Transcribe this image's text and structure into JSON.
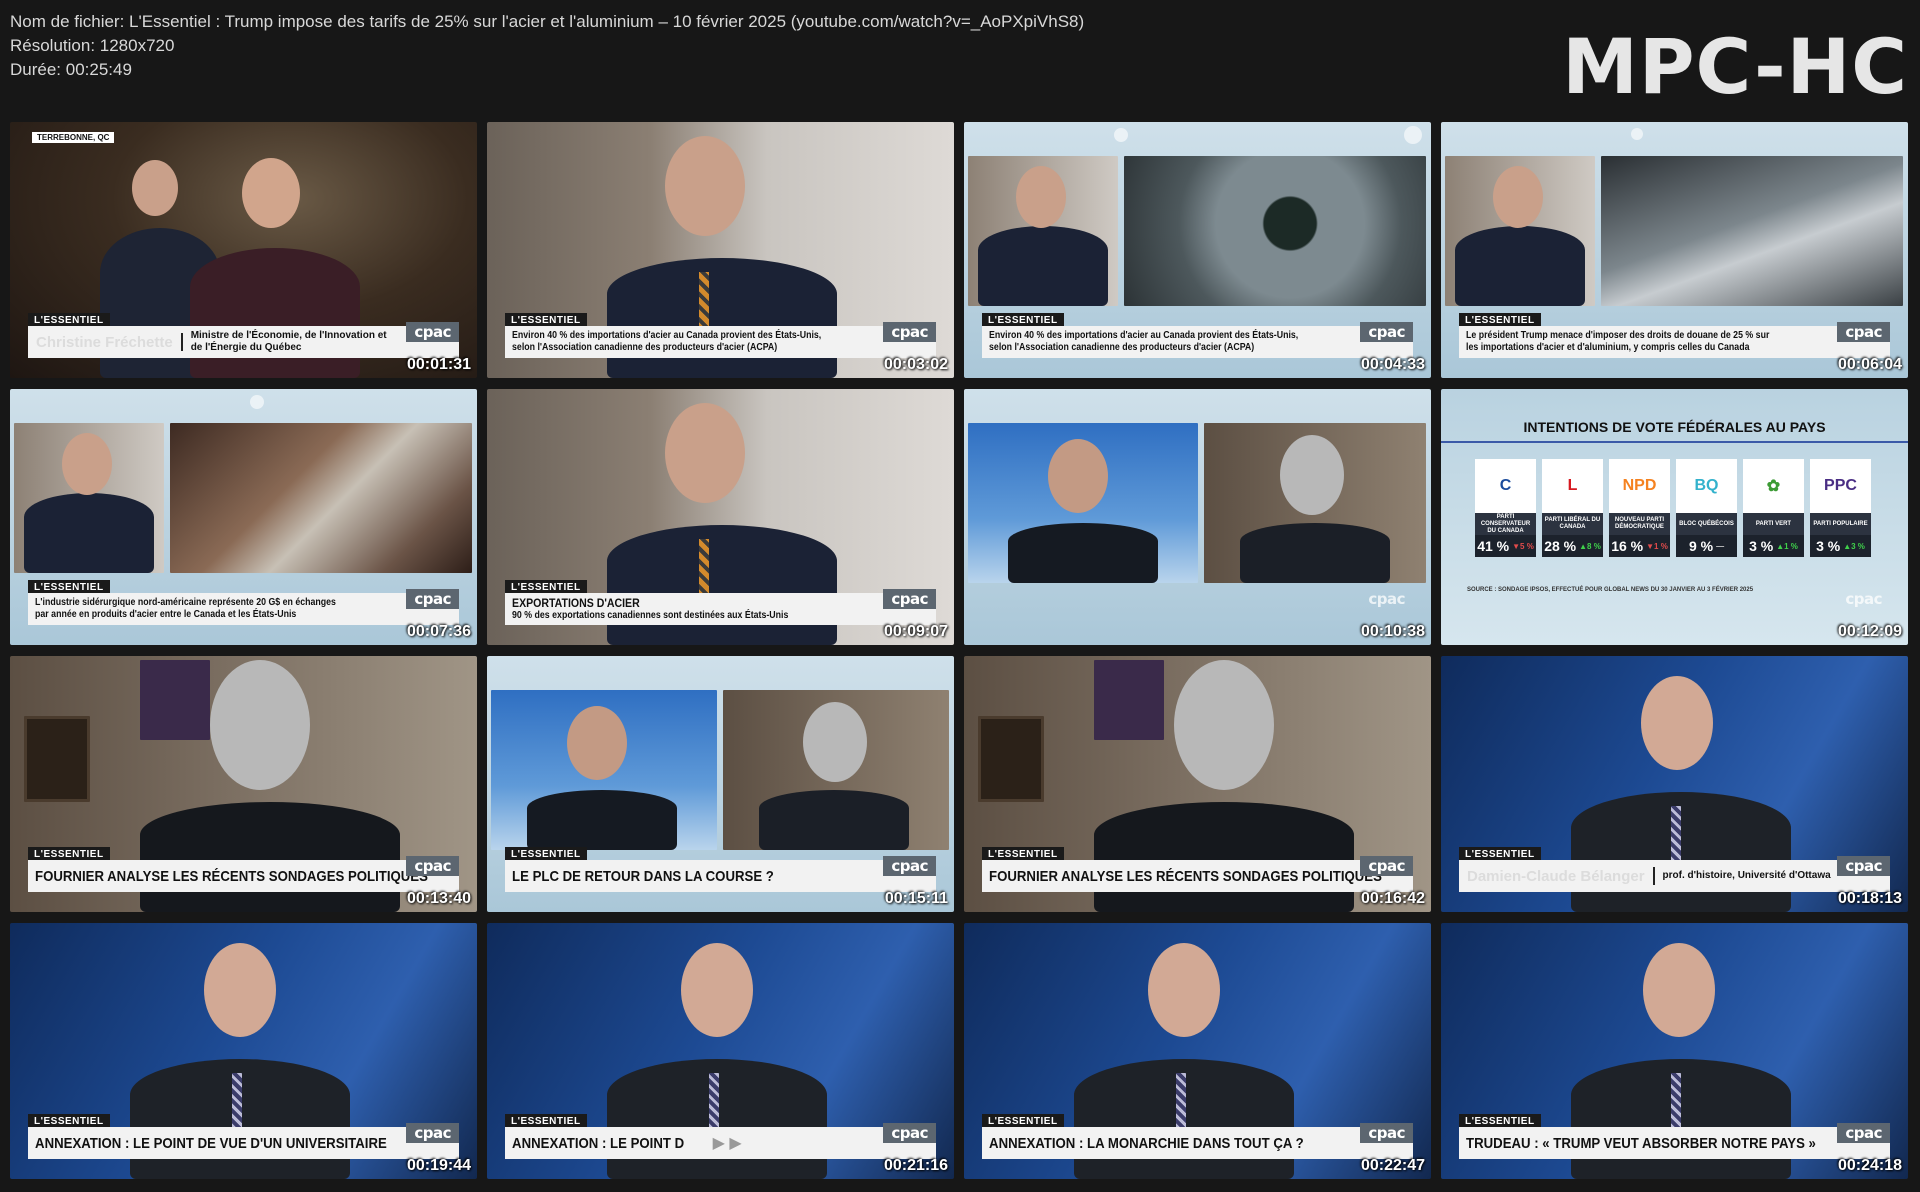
{
  "header": {
    "filename": "Nom de fichier: L'Essentiel : Trump impose des tarifs de 25% sur l'acier et l'aluminium – 10 février 2025 (youtube.com/watch?v=_AoPXpiVhS8)",
    "resolution": "Résolution: 1280x720",
    "duration": "Durée: 00:25:49",
    "logo": "MPC-HC"
  },
  "colors": {
    "background": "#171717",
    "banner": "#f2f2f2",
    "cpac": "#5c6670",
    "studio_blue": "#1d4a93"
  },
  "thumbs": [
    {
      "time": "00:01:31",
      "tag": "L'ESSENTIEL",
      "location": "TERREBONNE, QC",
      "name": "Christine Fréchette",
      "role": "Ministre de l'Économie, de l'Innovation et de l'Énergie du Québec",
      "cpac": "cpac"
    },
    {
      "time": "00:03:02",
      "tag": "L'ESSENTIEL",
      "text": "Environ 40 % des importations d'acier au Canada provient des États-Unis, selon l'Association canadienne des producteurs d'acier (ACPA)",
      "cpac": "cpac"
    },
    {
      "time": "00:04:33",
      "tag": "L'ESSENTIEL",
      "text": "Environ 40 % des importations d'acier au Canada provient des États-Unis, selon l'Association canadienne des producteurs d'acier (ACPA)",
      "cpac": "cpac"
    },
    {
      "time": "00:06:04",
      "tag": "L'ESSENTIEL",
      "text": "Le président Trump menace d'imposer des droits de douane de 25 % sur les importations d'acier et d'aluminium, y compris celles du Canada",
      "cpac": "cpac"
    },
    {
      "time": "00:07:36",
      "tag": "L'ESSENTIEL",
      "text": "L'industrie sidérurgique nord-américaine représente 20 G$ en échanges par année en produits d'acier entre le Canada et les États-Unis",
      "cpac": "cpac"
    },
    {
      "time": "00:09:07",
      "tag": "L'ESSENTIEL",
      "headline": "EXPORTATIONS D'ACIER",
      "text": "90 % des exportations canadiennes sont destinées aux États-Unis",
      "cpac": "cpac"
    },
    {
      "time": "00:10:38",
      "cpac": "cpac"
    },
    {
      "time": "00:12:09",
      "cpac": "cpac"
    },
    {
      "time": "00:13:40",
      "tag": "L'ESSENTIEL",
      "text": "FOURNIER ANALYSE LES RÉCENTS SONDAGES POLITIQUES",
      "cpac": "cpac"
    },
    {
      "time": "00:15:11",
      "tag": "L'ESSENTIEL",
      "text": "LE PLC DE RETOUR DANS LA COURSE ?",
      "cpac": "cpac"
    },
    {
      "time": "00:16:42",
      "tag": "L'ESSENTIEL",
      "text": "FOURNIER ANALYSE LES RÉCENTS SONDAGES POLITIQUES",
      "cpac": "cpac"
    },
    {
      "time": "00:18:13",
      "tag": "L'ESSENTIEL",
      "name": "Damien-Claude Bélanger",
      "role": "prof. d'histoire, Université d'Ottawa",
      "cpac": "cpac"
    },
    {
      "time": "00:19:44",
      "tag": "L'ESSENTIEL",
      "text": "ANNEXATION : LE POINT DE VUE D'UN UNIVERSITAIRE",
      "cpac": "cpac"
    },
    {
      "time": "00:21:16",
      "tag": "L'ESSENTIEL",
      "text": "ANNEXATION : LE POINT D",
      "cpac": "cpac"
    },
    {
      "time": "00:22:47",
      "tag": "L'ESSENTIEL",
      "text": "ANNEXATION : LA MONARCHIE DANS TOUT ÇA ?",
      "cpac": "cpac"
    },
    {
      "time": "00:24:18",
      "tag": "L'ESSENTIEL",
      "text": "TRUDEAU : « TRUMP VEUT ABSORBER NOTRE PAYS »",
      "cpac": "cpac"
    }
  ],
  "poll": {
    "title": "INTENTIONS DE VOTE FÉDÉRALES AU PAYS",
    "source": "SOURCE : SONDAGE IPSOS, EFFECTUÉ POUR GLOBAL NEWS DU 30 JANVIER AU 3 FÉVRIER 2025",
    "parties": [
      {
        "logo": "C",
        "name": "PARTI CONSERVATEUR DU CANADA",
        "pct": "41 %",
        "chg": "▼5 %",
        "color": "#1a4b9c"
      },
      {
        "logo": "L",
        "name": "PARTI LIBÉRAL DU CANADA",
        "pct": "28 %",
        "chg": "▲8 %",
        "color": "#d71920"
      },
      {
        "logo": "NPD",
        "name": "NOUVEAU PARTI DÉMOCRATIQUE",
        "pct": "16 %",
        "chg": "▼1 %",
        "color": "#f58220"
      },
      {
        "logo": "BQ",
        "name": "BLOC QUÉBÉCOIS",
        "pct": "9 %",
        "chg": "—",
        "color": "#33b2cc"
      },
      {
        "logo": "✿",
        "name": "PARTI VERT",
        "pct": "3 %",
        "chg": "▲1 %",
        "color": "#3d9b35"
      },
      {
        "logo": "PPC",
        "name": "PARTI POPULAIRE",
        "pct": "3 %",
        "chg": "▲3 %",
        "color": "#4a2e84"
      }
    ]
  }
}
